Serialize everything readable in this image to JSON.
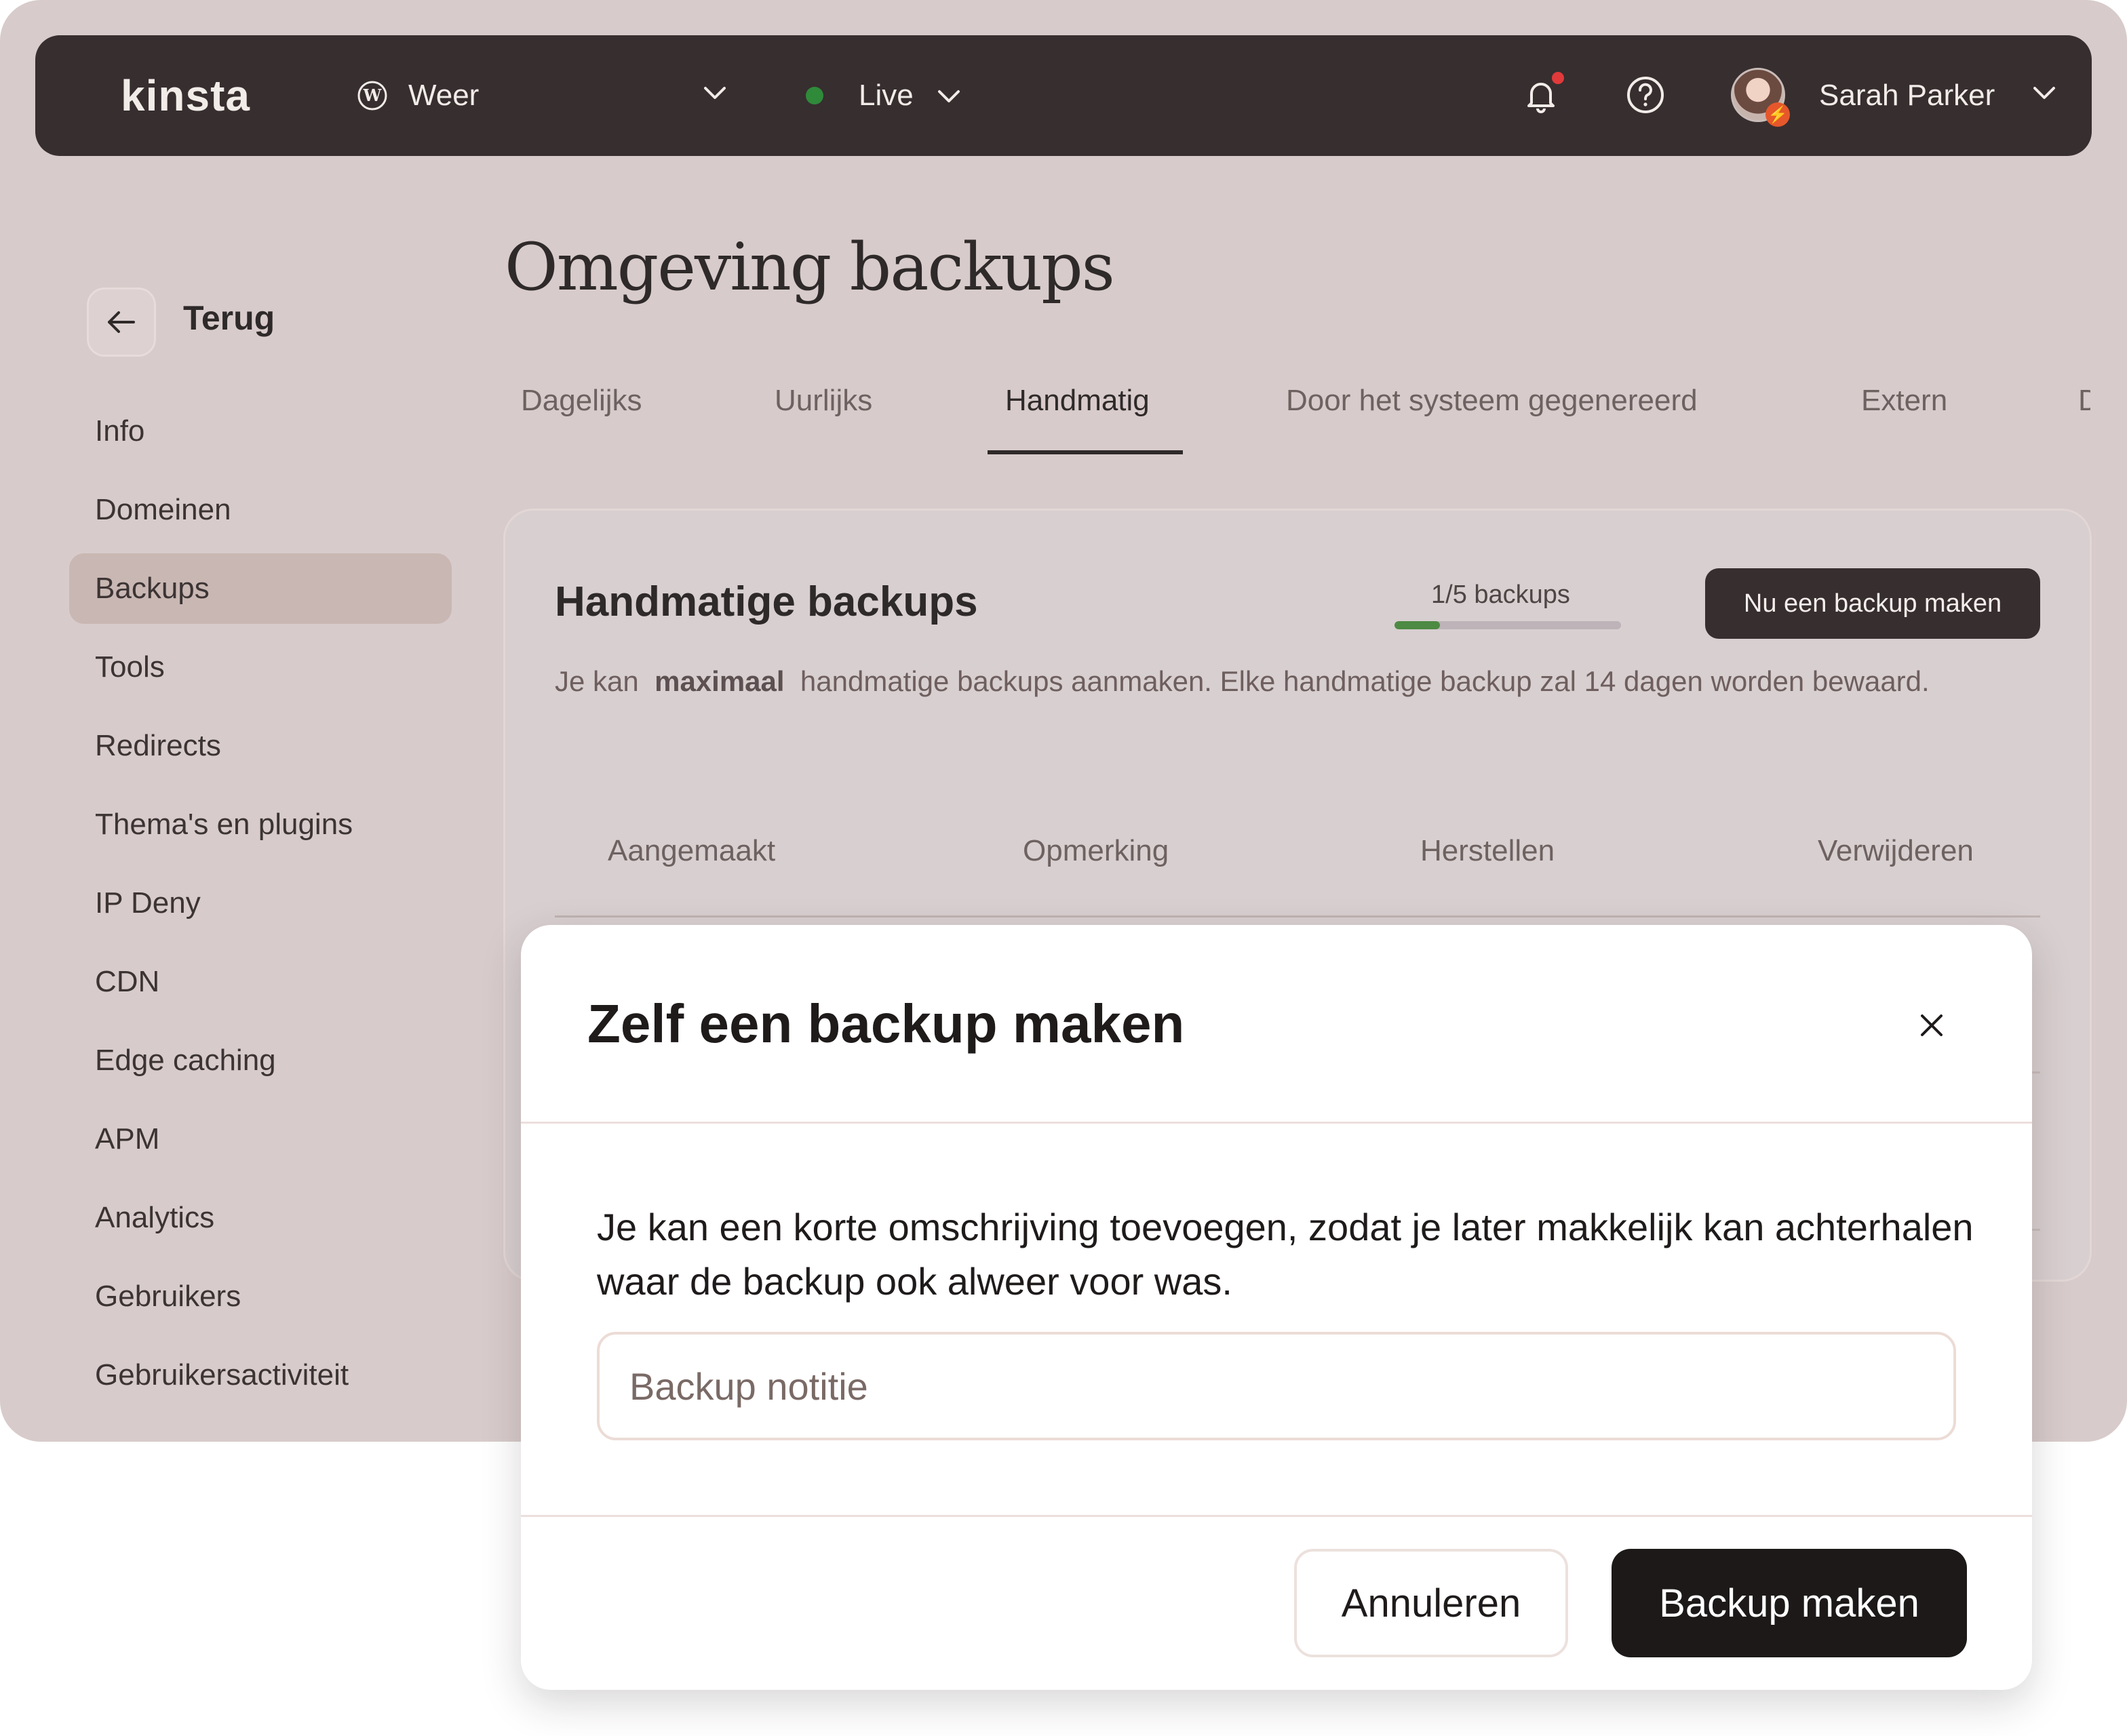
{
  "topbar": {
    "logo": "kinsta",
    "site_name": "Weer",
    "environment": "Live",
    "user_name": "Sarah Parker"
  },
  "sidebar": {
    "back_label": "Terug",
    "items": [
      {
        "label": "Info"
      },
      {
        "label": "Domeinen"
      },
      {
        "label": "Backups",
        "active": true
      },
      {
        "label": "Tools"
      },
      {
        "label": "Redirects"
      },
      {
        "label": "Thema's en plugins"
      },
      {
        "label": "IP Deny"
      },
      {
        "label": "CDN"
      },
      {
        "label": "Edge caching"
      },
      {
        "label": "APM"
      },
      {
        "label": "Analytics"
      },
      {
        "label": "Gebruikers"
      },
      {
        "label": "Gebruikersactiviteit"
      }
    ]
  },
  "main": {
    "page_title": "Omgeving backups",
    "tabs": [
      {
        "label": "Dagelijks"
      },
      {
        "label": "Uurlijks"
      },
      {
        "label": "Handmatig",
        "active": true
      },
      {
        "label": "Door het systeem gegenereerd"
      },
      {
        "label": "Extern"
      },
      {
        "label": "D"
      }
    ],
    "card": {
      "title": "Handmatige backups",
      "quota_label": "1/5 backups",
      "quota_used": 1,
      "quota_total": 5,
      "action_label": "Nu een backup maken",
      "description_prefix": "Je kan",
      "description_bold": "maximaal",
      "description_suffix": "handmatige backups aanmaken. Elke handmatige backup zal 14 dagen worden bewaard.",
      "columns": [
        "Aangemaakt",
        "Opmerking",
        "Herstellen",
        "Verwijderen"
      ]
    }
  },
  "modal": {
    "title": "Zelf een backup maken",
    "text": "Je kan een korte omschrijving toevoegen, zodat je later makkelijk kan achterhalen waar de backup ook alweer voor was.",
    "input_placeholder": "Backup notitie",
    "cancel_label": "Annuleren",
    "confirm_label": "Backup maken"
  },
  "colors": {
    "frame_bg": "#d8cbcb",
    "topbar_bg": "#372e2f",
    "live_dot": "#2f8a3a",
    "notification_badge": "#e23a3a",
    "quota_fill": "#4d8a43",
    "primary_button": "#1d1919"
  },
  "icons": [
    "wordpress-icon",
    "chevron-down-icon",
    "bell-icon",
    "help-icon",
    "avatar",
    "arrow-left-icon",
    "close-icon"
  ]
}
